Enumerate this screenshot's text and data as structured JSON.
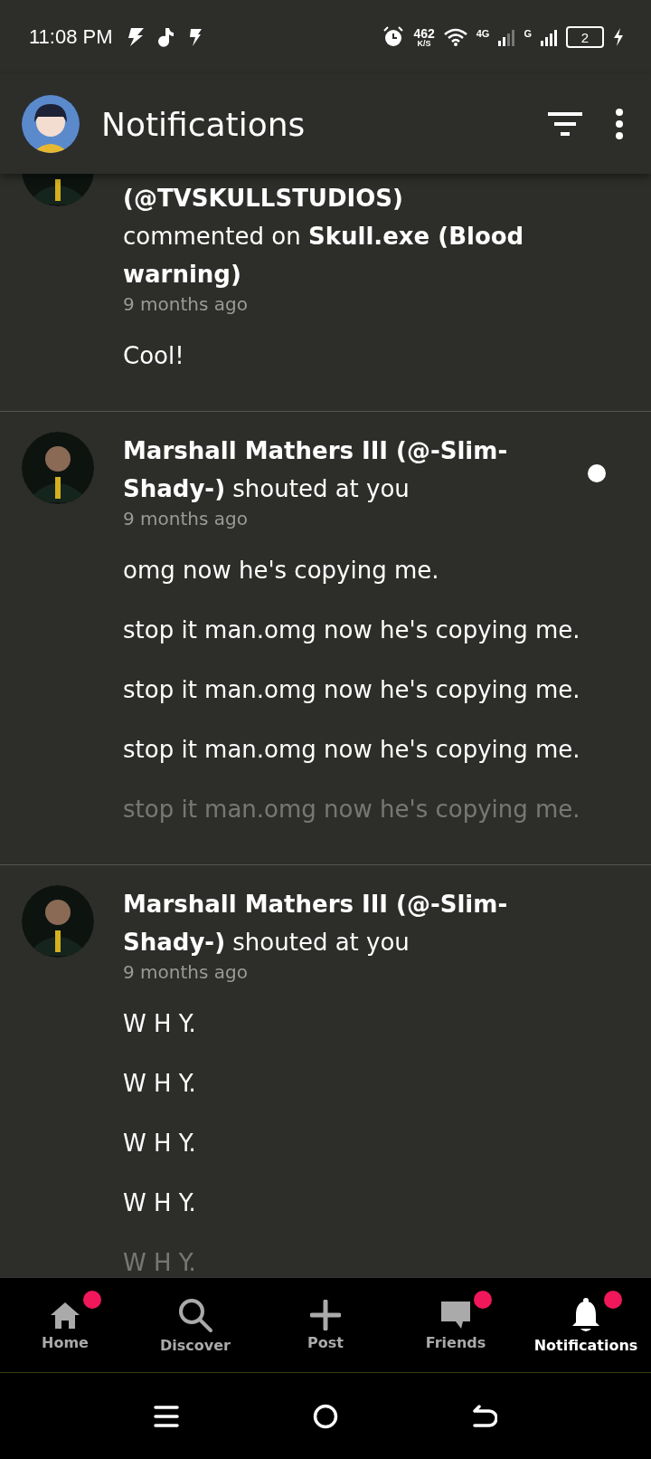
{
  "status_bar": {
    "time": "11:08 PM",
    "speed_value": "462",
    "speed_unit": "K/S",
    "network_1": "4G",
    "network_2": "G",
    "battery": "2"
  },
  "header": {
    "title": "Notifications"
  },
  "notifications": [
    {
      "title": "**(@TVSKULLSTUDIOS)** commented on **Skull.exe (Blood warning)**",
      "time": "9 months ago",
      "unread": false,
      "messages": [
        "Cool!"
      ]
    },
    {
      "title": "**Marshall Mathers III (@-Slim-Shady-)** shouted at you",
      "time": "9 months ago",
      "unread": true,
      "messages": [
        "omg now he's copying me.",
        "stop it man.omg now he's copying me.",
        "stop it man.omg now he's copying me.",
        "stop it man.omg now he's copying me.",
        "stop it man.omg now he's copying me."
      ]
    },
    {
      "title": "**Marshall Mathers III (@-Slim-Shady-)** shouted at you",
      "time": "9 months ago",
      "unread": false,
      "messages": [
        "W H Y.",
        "W H Y.",
        "W H Y.",
        "W H Y.",
        "W H Y."
      ]
    }
  ],
  "bottom_nav": [
    {
      "kind": "home",
      "label": "Home",
      "badge": true,
      "selected": false
    },
    {
      "kind": "search",
      "label": "Discover",
      "badge": false,
      "selected": false
    },
    {
      "kind": "plus",
      "label": "Post",
      "badge": false,
      "selected": false
    },
    {
      "kind": "chat",
      "label": "Friends",
      "badge": true,
      "selected": false
    },
    {
      "kind": "bell",
      "label": "Notifications",
      "badge": true,
      "selected": true
    }
  ]
}
